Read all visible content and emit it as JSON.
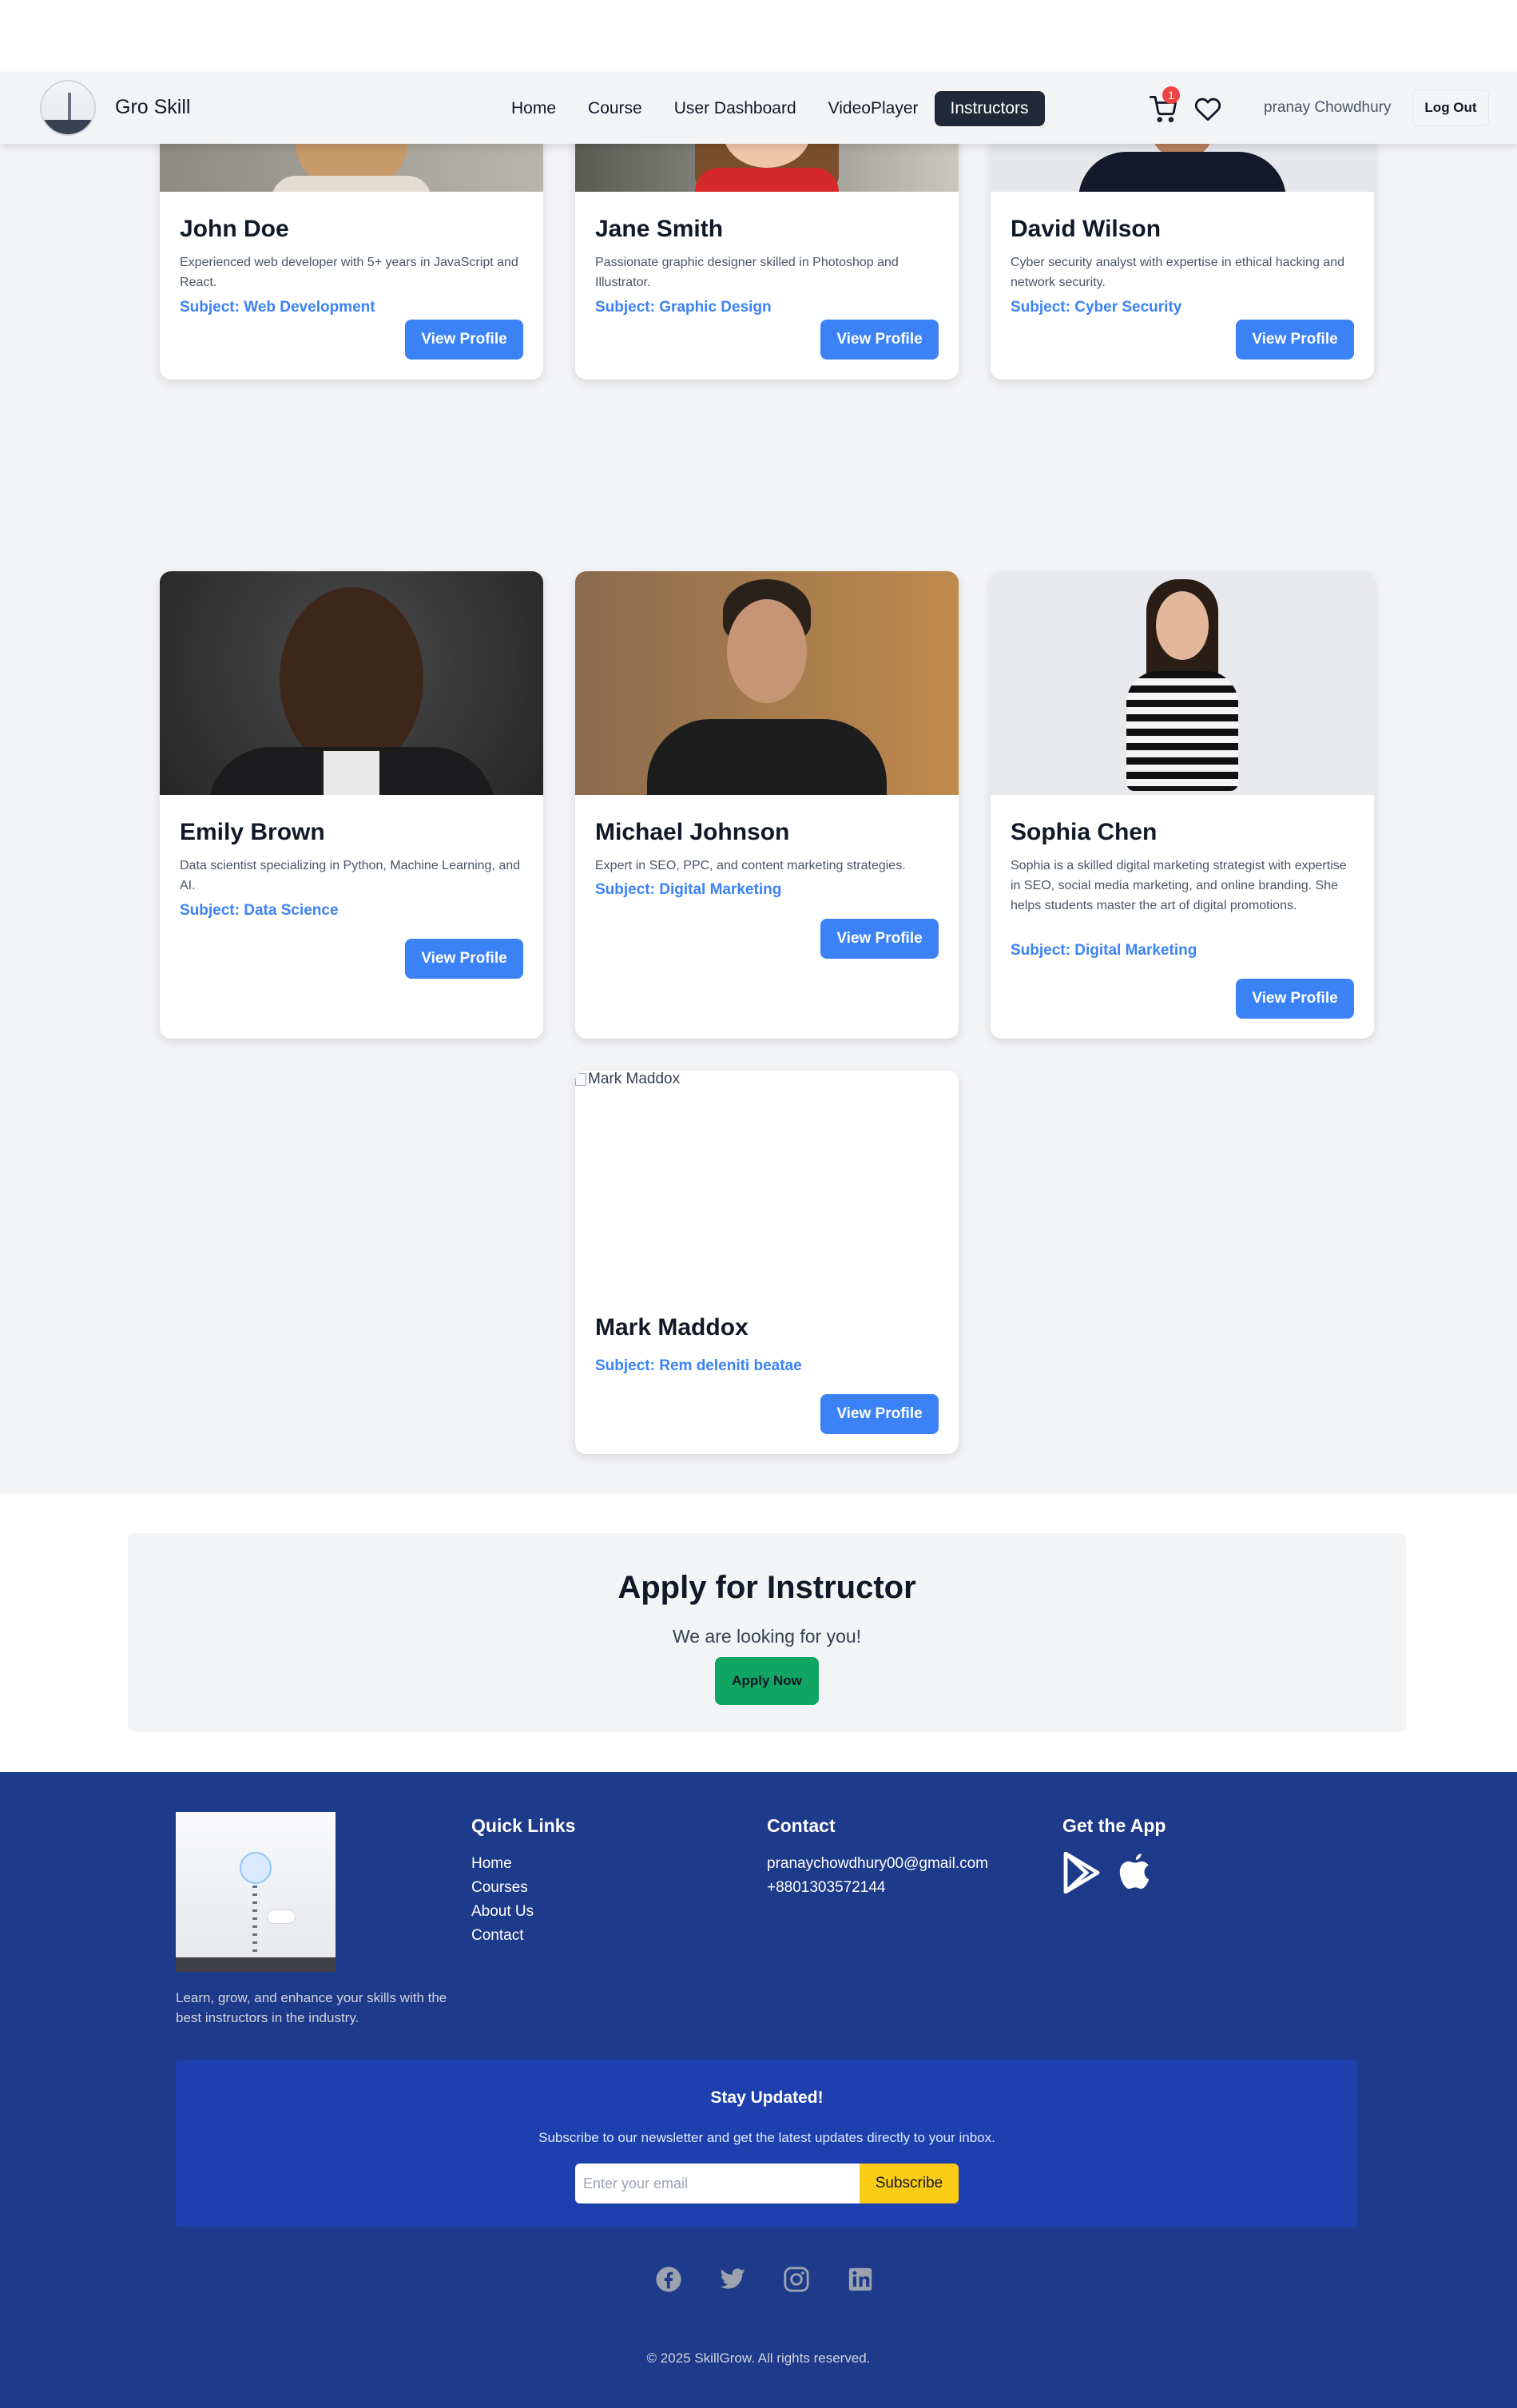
{
  "brand": {
    "name": "Gro Skill"
  },
  "nav": {
    "links": [
      "Home",
      "Course",
      "User Dashboard",
      "VideoPlayer",
      "Instructors"
    ],
    "active": "Instructors",
    "cart_count": "1",
    "username": "pranay Chowdhury",
    "logout_label": "Log Out"
  },
  "instructors": [
    {
      "name": "John Doe",
      "description": "Experienced web developer with 5+ years in JavaScript and React.",
      "subject": "Subject: Web Development",
      "button": "View Profile"
    },
    {
      "name": "Jane Smith",
      "description": "Passionate graphic designer skilled in Photoshop and Illustrator.",
      "subject": "Subject: Graphic Design",
      "button": "View Profile"
    },
    {
      "name": "David Wilson",
      "description": "Cyber security analyst with expertise in ethical hacking and network security.",
      "subject": "Subject: Cyber Security",
      "button": "View Profile"
    },
    {
      "name": "Emily Brown",
      "description": "Data scientist specializing in Python, Machine Learning, and AI.",
      "subject": "Subject: Data Science",
      "button": "View Profile"
    },
    {
      "name": "Michael Johnson",
      "description": "Expert in SEO, PPC, and content marketing strategies.",
      "subject": "Subject: Digital Marketing",
      "button": "View Profile"
    },
    {
      "name": "Sophia Chen",
      "description": "Sophia is a skilled digital marketing strategist with expertise in SEO, social media marketing, and online branding. She helps students master the art of digital promotions.",
      "subject": "Subject: Digital Marketing",
      "button": "View Profile"
    },
    {
      "name": "Mark Maddox",
      "image_alt": "Mark Maddox",
      "subject": "Subject: Rem deleniti beatae",
      "button": "View Profile"
    }
  ],
  "apply": {
    "title": "Apply for Instructor",
    "subtitle": "We are looking for you!",
    "button": "Apply Now"
  },
  "footer": {
    "tagline": "Learn, grow, and enhance your skills with the best instructors in the industry.",
    "quick_links_title": "Quick Links",
    "quick_links": [
      "Home",
      "Courses",
      "About Us",
      "Contact"
    ],
    "contact_title": "Contact",
    "email": "pranaychowdhury00@gmail.com",
    "phone": "+8801303572144",
    "app_title": "Get the App",
    "newsletter": {
      "title": "Stay Updated!",
      "subtitle": "Subscribe to our newsletter and get the latest updates directly to your inbox.",
      "placeholder": "Enter your email",
      "button": "Subscribe"
    },
    "copyright": "© 2025 SkillGrow. All rights reserved."
  }
}
